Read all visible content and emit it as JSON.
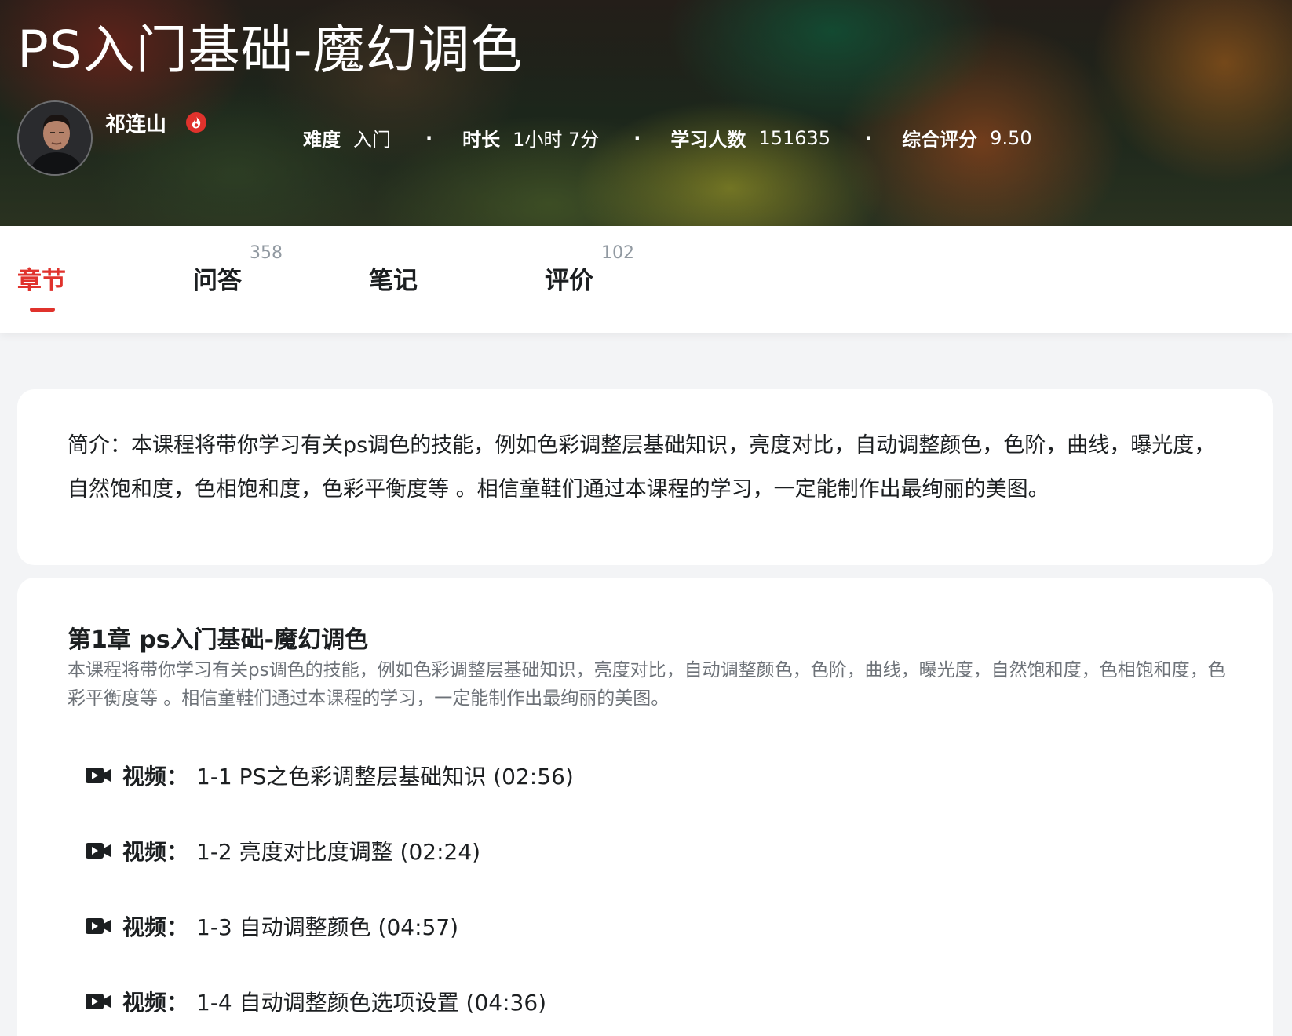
{
  "course": {
    "title": "PS入门基础-魔幻调色",
    "teacher_name": "祁连山"
  },
  "stats": [
    {
      "label": "难度",
      "value": "入门"
    },
    {
      "label": "时长",
      "value": "1小时 7分"
    },
    {
      "label": "学习人数",
      "value": "151635"
    },
    {
      "label": "综合评分",
      "value": "9.50"
    }
  ],
  "stat_separator": "·",
  "tabs": [
    {
      "label": "章节",
      "count": "",
      "active": true
    },
    {
      "label": "问答",
      "count": "358",
      "active": false
    },
    {
      "label": "笔记",
      "count": "",
      "active": false
    },
    {
      "label": "评价",
      "count": "102",
      "active": false
    }
  ],
  "intro": "简介：本课程将带你学习有关ps调色的技能，例如色彩调整层基础知识，亮度对比，自动调整颜色，色阶，曲线，曝光度，自然饱和度，色相饱和度，色彩平衡度等 。相信童鞋们通过本课程的学习，一定能制作出最绚丽的美图。",
  "chapter": {
    "title": "第1章 ps入门基础-魔幻调色",
    "description": "本课程将带你学习有关ps调色的技能，例如色彩调整层基础知识，亮度对比，自动调整颜色，色阶，曲线，曝光度，自然饱和度，色相饱和度，色彩平衡度等 。相信童鞋们通过本课程的学习，一定能制作出最绚丽的美图。",
    "lessons": [
      {
        "type": "视频：",
        "name": "1-1 PS之色彩调整层基础知识 (02:56)",
        "icon": "video-camera-icon"
      },
      {
        "type": "视频：",
        "name": "1-2 亮度对比度调整 (02:24)",
        "icon": "video-camera-icon"
      },
      {
        "type": "视频：",
        "name": "1-3 自动调整颜色 (04:57)",
        "icon": "video-camera-icon"
      },
      {
        "type": "视频：",
        "name": "1-4 自动调整颜色选项设置 (04:36)",
        "icon": "video-camera-icon"
      }
    ]
  },
  "colors": {
    "accent": "#e0322c",
    "text": "#1c1f21",
    "muted": "#9199a1",
    "page_bg": "#f3f4f6"
  }
}
